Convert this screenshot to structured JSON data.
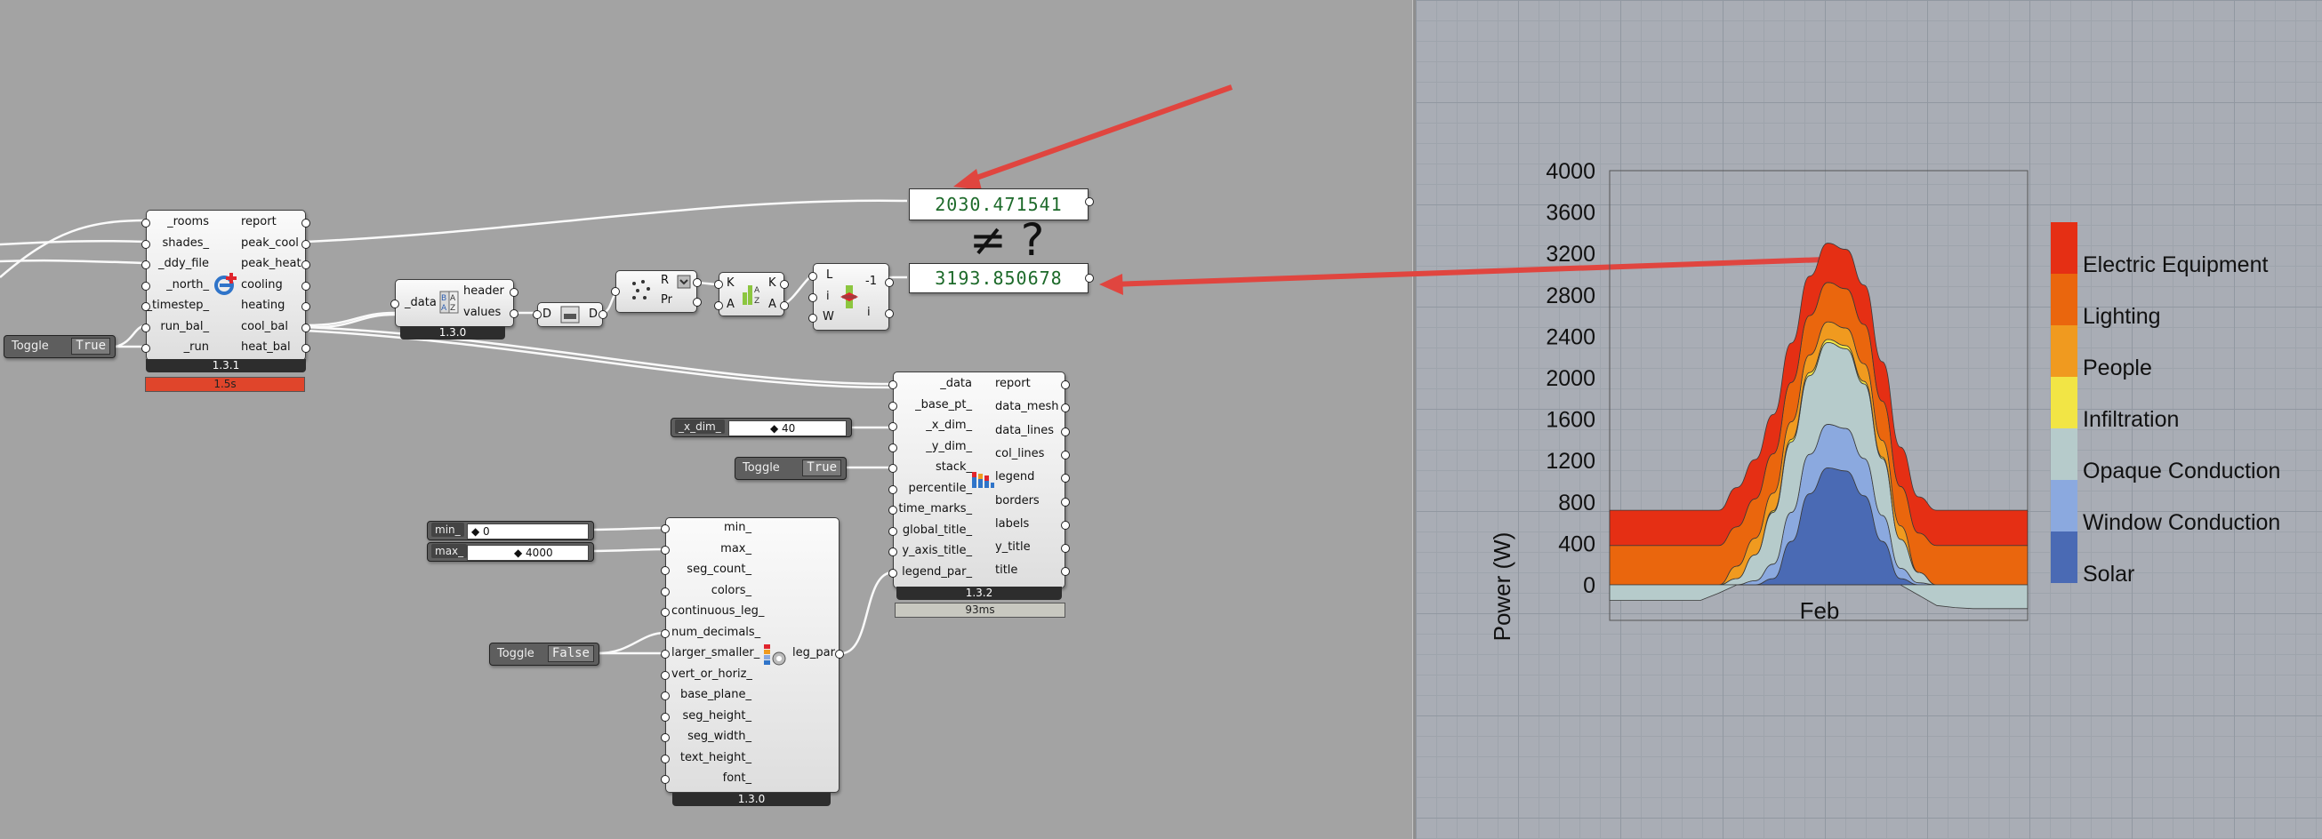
{
  "components": {
    "main": {
      "inputs": [
        "_rooms",
        "shades_",
        "_ddy_file",
        "_north_",
        "_timestep_",
        "run_bal_",
        "_run"
      ],
      "outputs": [
        "report",
        "peak_cool",
        "peak_heat",
        "cooling",
        "heating",
        "cool_bal",
        "heat_bal"
      ],
      "version": "1.3.1",
      "time": "1.5s",
      "icon": "energy-plus-icon"
    },
    "headers": {
      "inputs": [
        "_data"
      ],
      "outputs": [
        "header",
        "values"
      ],
      "version": "1.3.0",
      "icon": "az-sort-icon"
    },
    "flatten": {
      "input": "D",
      "output": "D",
      "icon": "flatten-icon"
    },
    "bounds": {
      "inputs": [
        "R",
        "Pr"
      ],
      "icon": "bounds-icon"
    },
    "sort": {
      "inputs": [
        "K",
        "A"
      ],
      "outputs": [
        "K",
        "A"
      ],
      "icon": "sort-icon"
    },
    "list_item": {
      "inputs": [
        "L",
        "i",
        "W"
      ],
      "outputs": [
        "-1",
        "i"
      ],
      "icon": "list-item-icon"
    },
    "chart": {
      "inputs": [
        "_data",
        "_base_pt_",
        "_x_dim_",
        "_y_dim_",
        "stack_",
        "percentile_",
        "time_marks_",
        "global_title_",
        "y_axis_title_",
        "legend_par_"
      ],
      "outputs": [
        "report",
        "data_mesh",
        "data_lines",
        "col_lines",
        "legend",
        "borders",
        "labels",
        "y_title",
        "title"
      ],
      "version": "1.3.2",
      "time": "93ms",
      "icon": "monthly-chart-icon"
    },
    "legend_par": {
      "inputs": [
        "min_",
        "max_",
        "seg_count_",
        "colors_",
        "continuous_leg_",
        "num_decimals_",
        "larger_smaller_",
        "vert_or_horiz_",
        "base_plane_",
        "seg_height_",
        "seg_width_",
        "text_height_",
        "font_"
      ],
      "outputs": [
        "leg_par"
      ],
      "version": "1.3.0",
      "icon": "legend-par-icon"
    }
  },
  "panels": {
    "top_value": "2030.471541",
    "bottom_value": "3193.850678",
    "annotation": "≠ ?"
  },
  "toggles": {
    "run": {
      "label": "Toggle",
      "value": "True"
    },
    "stack": {
      "label": "Toggle",
      "value": "True"
    },
    "larger_smaller": {
      "label": "Toggle",
      "value": "False"
    }
  },
  "sliders": {
    "x_dim": {
      "label": "_x_dim_",
      "value": "◆ 40"
    },
    "min": {
      "label": "min_",
      "value": "◆ 0"
    },
    "max": {
      "label": "max_",
      "value": "◆ 4000"
    }
  },
  "colors": {
    "arrow": "#e0453f",
    "time_bad": "#e0452b",
    "time_ok": "#c8c8c0",
    "panel_text": "#1d6a2a"
  },
  "chart_data": {
    "type": "area",
    "ylabel": "Power (W)",
    "xlabel": "Feb",
    "yticks": [
      0,
      400,
      800,
      1200,
      1600,
      2000,
      2400,
      2800,
      3200,
      3600,
      4000
    ],
    "ylim": [
      0,
      4000
    ],
    "legend_position": "right",
    "x_hours": [
      0,
      1,
      2,
      3,
      4,
      5,
      6,
      7,
      8,
      9,
      10,
      11,
      12,
      13,
      14,
      15,
      16,
      17,
      18,
      19,
      20,
      21,
      22,
      23
    ],
    "series": [
      {
        "name": "Solar",
        "color": "#4a6ab4",
        "values": [
          0,
          0,
          0,
          0,
          0,
          0,
          0,
          0,
          0,
          60,
          420,
          880,
          1130,
          1100,
          860,
          420,
          60,
          0,
          0,
          0,
          0,
          0,
          0,
          0
        ]
      },
      {
        "name": "Window Conduction",
        "color": "#8ba9df",
        "values": [
          0,
          0,
          0,
          0,
          0,
          0,
          0,
          0,
          40,
          140,
          280,
          380,
          420,
          410,
          360,
          250,
          100,
          20,
          0,
          0,
          0,
          0,
          0,
          0
        ]
      },
      {
        "name": "Opaque Conduction",
        "color": "#b6cbcb",
        "values": [
          0,
          0,
          0,
          0,
          0,
          0,
          0,
          60,
          250,
          500,
          680,
          760,
          790,
          770,
          720,
          550,
          280,
          100,
          0,
          0,
          0,
          0,
          0,
          0
        ]
      },
      {
        "name": "Infiltration",
        "color": "#f2e545",
        "values": [
          0,
          0,
          0,
          0,
          0,
          0,
          0,
          0,
          0,
          15,
          25,
          30,
          30,
          30,
          25,
          15,
          0,
          0,
          0,
          0,
          0,
          0,
          0,
          0
        ]
      },
      {
        "name": "People",
        "color": "#f09a1f",
        "values": [
          0,
          0,
          0,
          0,
          0,
          0,
          0,
          120,
          160,
          170,
          170,
          170,
          170,
          170,
          170,
          160,
          130,
          0,
          0,
          0,
          0,
          0,
          0,
          0
        ]
      },
      {
        "name": "Lighting",
        "color": "#ea660d",
        "values": [
          380,
          380,
          380,
          380,
          380,
          380,
          380,
          380,
          380,
          380,
          380,
          380,
          380,
          380,
          380,
          380,
          380,
          380,
          380,
          380,
          380,
          380,
          380,
          380
        ]
      },
      {
        "name": "Electric Equipment",
        "color": "#e52f14",
        "values": [
          340,
          340,
          340,
          340,
          340,
          340,
          340,
          380,
          380,
          380,
          380,
          380,
          380,
          380,
          380,
          380,
          380,
          350,
          340,
          340,
          340,
          340,
          340,
          340
        ]
      }
    ],
    "negative_series": {
      "name": "Opaque Conduction",
      "values": [
        -150,
        -150,
        -150,
        -150,
        -150,
        -150,
        -80,
        0,
        0,
        0,
        0,
        0,
        0,
        0,
        0,
        0,
        0,
        -100,
        -200,
        -220,
        -230,
        -230,
        -230,
        -230
      ]
    }
  }
}
